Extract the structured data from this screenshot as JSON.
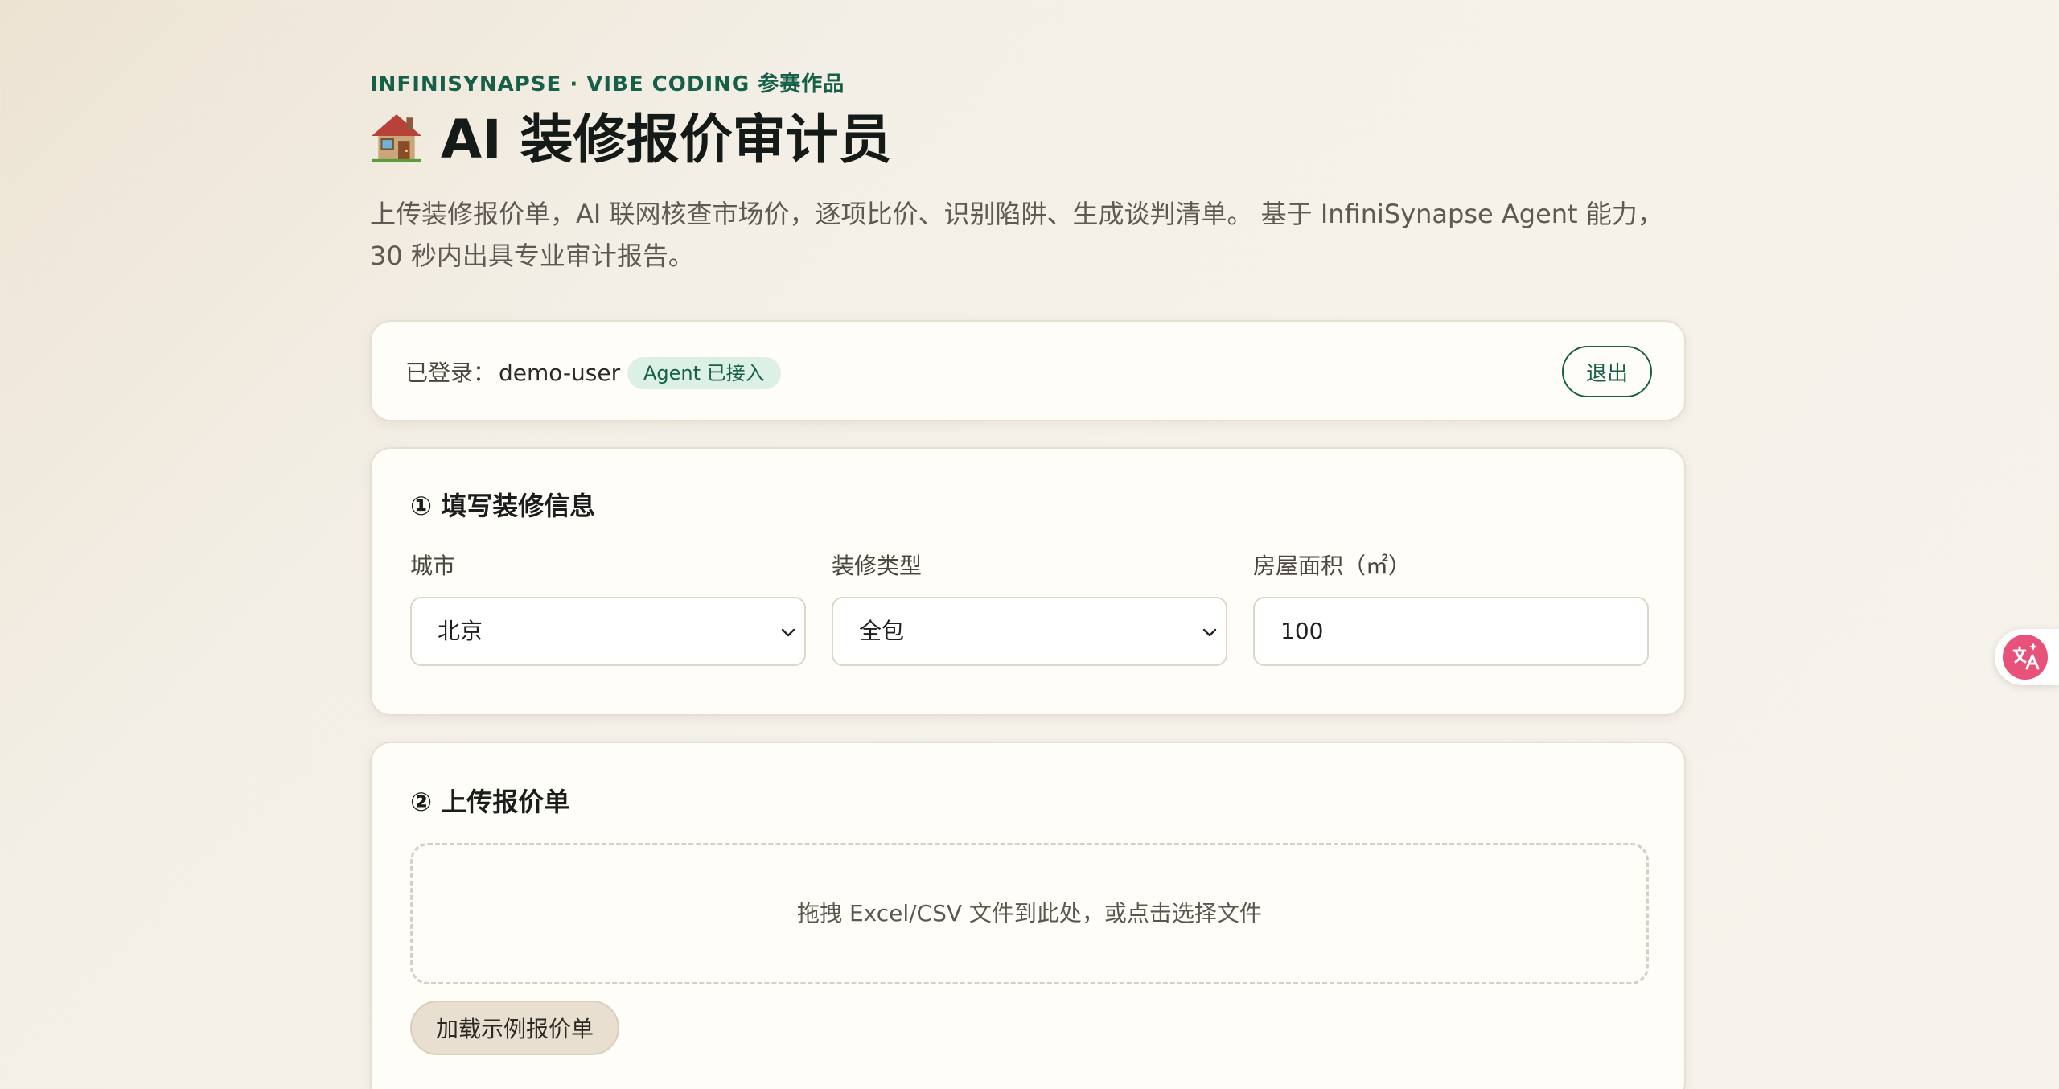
{
  "header": {
    "eyebrow": "INFINISYNAPSE · VIBE CODING 参赛作品",
    "title": "AI 装修报价审计员",
    "title_icon": "house-icon",
    "description": "上传装修报价单，AI 联网核查市场价，逐项比价、识别陷阱、生成谈判清单。 基于 InfiniSynapse Agent 能力，30 秒内出具专业审计报告。"
  },
  "login": {
    "label": "已登录：",
    "username": "demo-user",
    "badge": "Agent 已接入",
    "logout_label": "退出"
  },
  "info_section": {
    "title": "① 填写装修信息",
    "city": {
      "label": "城市",
      "value": "北京"
    },
    "type": {
      "label": "装修类型",
      "value": "全包"
    },
    "area": {
      "label": "房屋面积（㎡）",
      "value": "100"
    }
  },
  "upload_section": {
    "title": "② 上传报价单",
    "dropzone_text": "拖拽 Excel/CSV 文件到此处，或点击选择文件",
    "sample_label": "加载示例报价单"
  },
  "colors": {
    "accent": "#16604a",
    "badge_bg": "#ddf0e6",
    "translate_icon": "#e8527a"
  }
}
